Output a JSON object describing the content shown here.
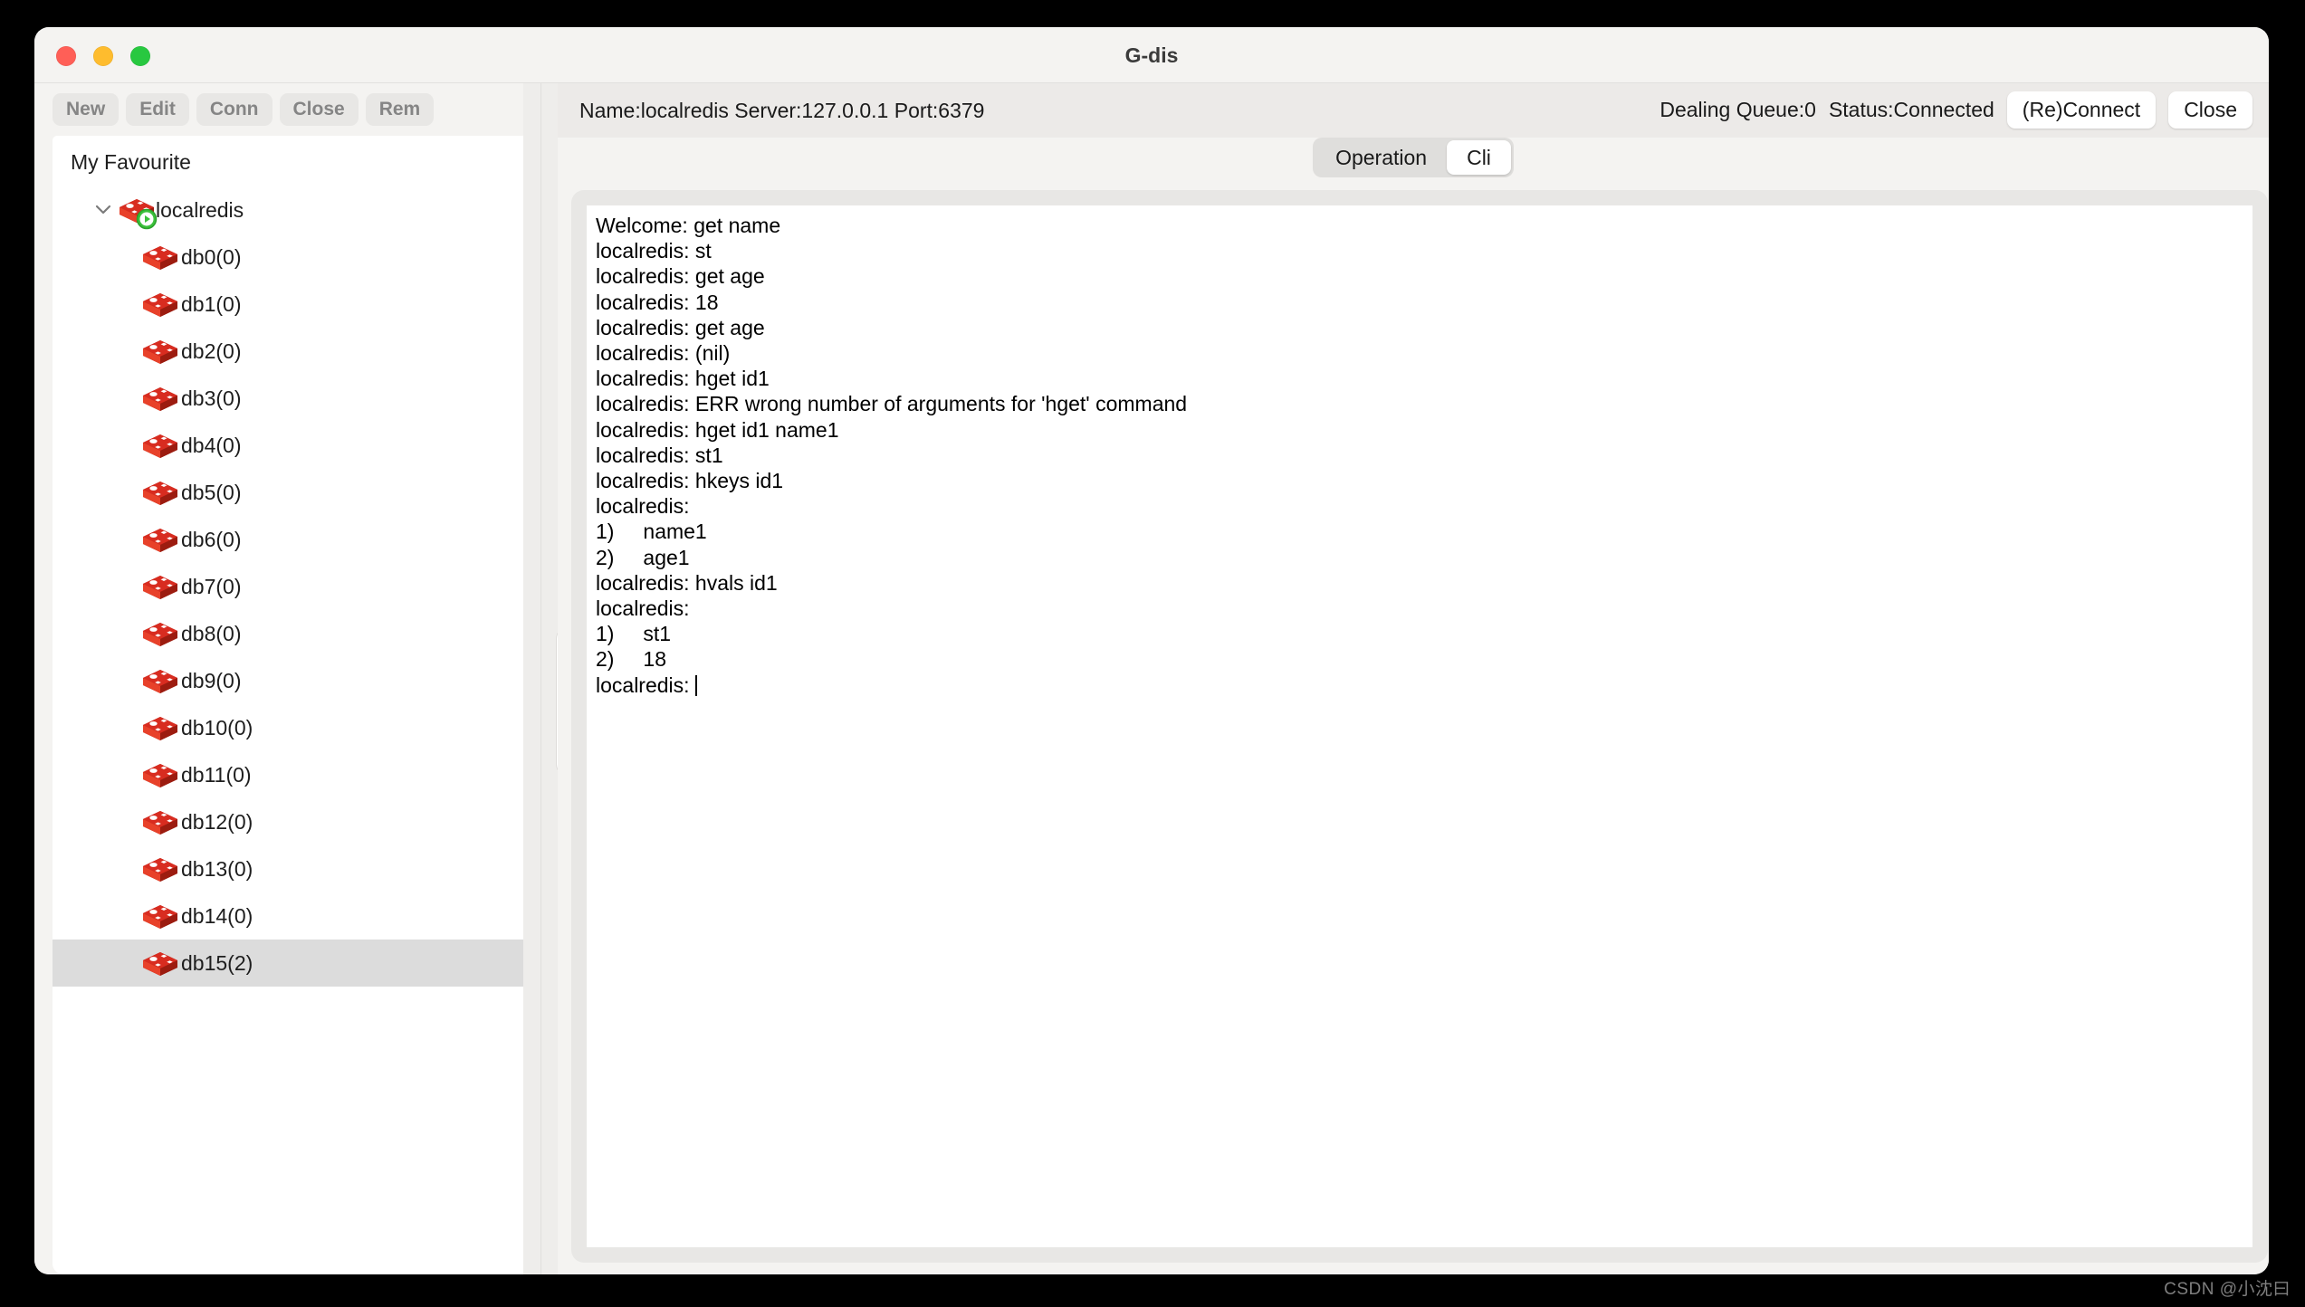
{
  "window": {
    "title": "G-dis",
    "traffic_lights": [
      {
        "name": "close",
        "color": "#ff5f57"
      },
      {
        "name": "minimize",
        "color": "#febc2e"
      },
      {
        "name": "maximize",
        "color": "#28c840"
      }
    ]
  },
  "toolbar": {
    "buttons": [
      {
        "label": "New"
      },
      {
        "label": "Edit"
      },
      {
        "label": "Conn"
      },
      {
        "label": "Close"
      },
      {
        "label": "Rem"
      }
    ]
  },
  "sidebar": {
    "title": "My Favourite",
    "root": {
      "label": "localredis",
      "icon": "redis-icon",
      "badge": "connected-badge",
      "expanded": true,
      "chevron": "chevron-down-icon"
    },
    "databases": [
      {
        "label": "db0(0)"
      },
      {
        "label": "db1(0)"
      },
      {
        "label": "db2(0)"
      },
      {
        "label": "db3(0)"
      },
      {
        "label": "db4(0)"
      },
      {
        "label": "db5(0)"
      },
      {
        "label": "db6(0)"
      },
      {
        "label": "db7(0)"
      },
      {
        "label": "db8(0)"
      },
      {
        "label": "db9(0)"
      },
      {
        "label": "db10(0)"
      },
      {
        "label": "db11(0)"
      },
      {
        "label": "db12(0)"
      },
      {
        "label": "db13(0)"
      },
      {
        "label": "db14(0)"
      },
      {
        "label": "db15(2)"
      }
    ],
    "selected_index": 15
  },
  "connection_bar": {
    "info": "Name:localredis Server:127.0.0.1 Port:6379",
    "queue": "Dealing Queue:0",
    "status": "Status:Connected",
    "reconnect_label": "(Re)Connect",
    "close_label": "Close"
  },
  "tabs": [
    {
      "label": "Operation",
      "active": false
    },
    {
      "label": "Cli",
      "active": true
    }
  ],
  "console": {
    "lines": [
      "Welcome: get name",
      "localredis: st",
      "localredis: get age",
      "localredis: 18",
      "localredis: get age",
      "localredis: (nil)",
      "localredis: hget id1",
      "localredis: ERR wrong number of arguments for 'hget' command",
      "localredis: hget id1 name1",
      "localredis: st1",
      "localredis: hkeys id1",
      "localredis:",
      "1)     name1",
      "2)     age1",
      "localredis: hvals id1",
      "localredis:",
      "1)     st1",
      "2)     18"
    ],
    "prompt": "localredis: "
  },
  "watermark": "CSDN @小沈曰",
  "colors": {
    "redis_red": "#d82c20",
    "redis_red_dark": "#a41e11",
    "accent_green": "#3cc13c",
    "selection": "#dcdcdc",
    "window_bg": "#f4f3f1"
  }
}
